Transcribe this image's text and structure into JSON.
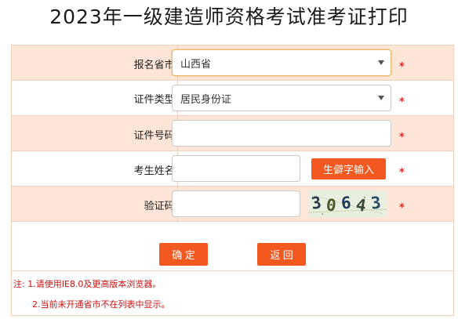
{
  "page": {
    "title": "2023年一级建造师资格考试准考证打印"
  },
  "form": {
    "province": {
      "label": "报名省市:",
      "value": "山西省"
    },
    "id_type": {
      "label": "证件类型:",
      "value": "居民身份证"
    },
    "id_number": {
      "label": "证件号码:",
      "value": "",
      "placeholder": ""
    },
    "name": {
      "label": "考生姓名:",
      "value": "",
      "placeholder": "",
      "rare_char_button": "生僻字输入"
    },
    "captcha": {
      "label": "验证码:",
      "value": "",
      "placeholder": "",
      "image_text": "30643"
    },
    "required_mark": "*"
  },
  "actions": {
    "confirm": "确 定",
    "back": "返 回"
  },
  "notes": {
    "line1": "注: 1.请使用IE8.0及更高版本浏览器。",
    "line2": "2.当前未开通省市不在列表中显示。"
  },
  "colors": {
    "accent": "#f2581f",
    "row_shade": "#fde6d7",
    "border": "#f1cfbf",
    "required": "#e02a2a",
    "note_text": "#d01111"
  }
}
